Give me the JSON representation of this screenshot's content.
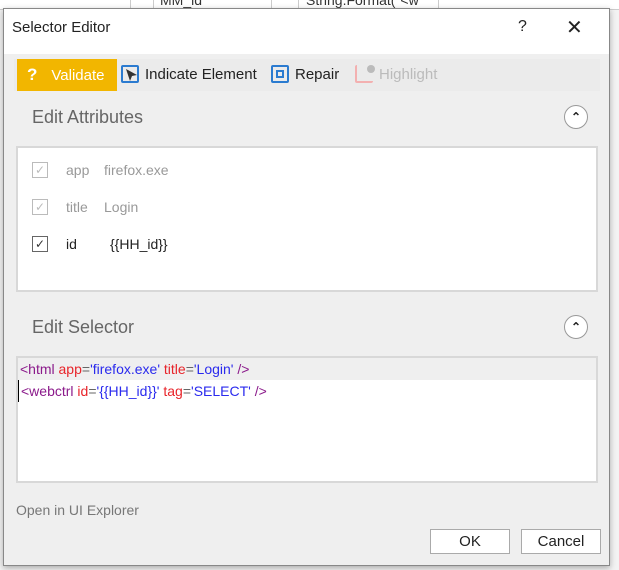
{
  "background": {
    "cells": [
      "MM_id",
      "String.Format(\"<w"
    ]
  },
  "dialog": {
    "title": "Selector Editor",
    "help": "?",
    "close": "✕"
  },
  "toolbar": {
    "validate": "Validate",
    "validate_icon": "?",
    "indicate": "Indicate Element",
    "repair": "Repair",
    "highlight": "Highlight"
  },
  "attributes": {
    "heading": "Edit Attributes",
    "chevron": "⌃",
    "rows": [
      {
        "name": "app",
        "value": "firefox.exe",
        "checked": true,
        "enabled": false
      },
      {
        "name": "title",
        "value": "Login",
        "checked": true,
        "enabled": false
      },
      {
        "name": "id",
        "value": "{{HH_id}}",
        "checked": true,
        "enabled": true
      }
    ]
  },
  "selector": {
    "heading": "Edit Selector",
    "chevron": "⌃",
    "lines": [
      {
        "tag": "<html",
        "attrs": [
          {
            "n": " app",
            "eq": "=",
            "v": "'firefox.exe'"
          },
          {
            "n": " title",
            "eq": "=",
            "v": "'Login'"
          }
        ],
        "end": " />"
      },
      {
        "tag": "<webctrl",
        "attrs": [
          {
            "n": " id",
            "eq": "=",
            "v": "'{{HH_id}}'"
          },
          {
            "n": " tag",
            "eq": "=",
            "v": "'SELECT'"
          }
        ],
        "end": " />"
      }
    ]
  },
  "footer": {
    "link": "Open in UI Explorer",
    "ok": "OK",
    "cancel": "Cancel"
  },
  "check_mark": "✓"
}
